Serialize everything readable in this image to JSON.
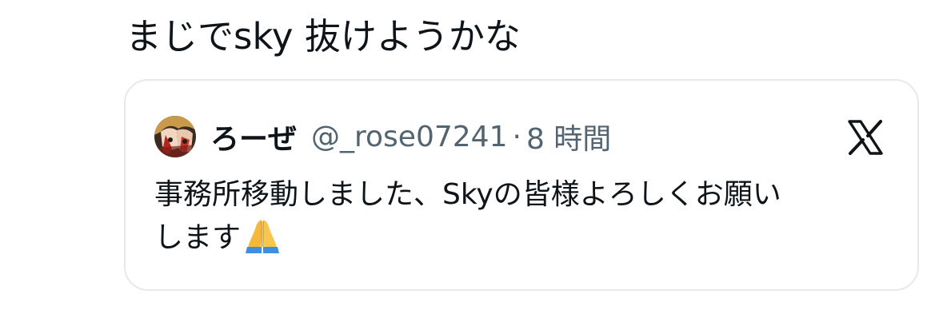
{
  "post": {
    "text": "まじでsky 抜けようかな"
  },
  "quote": {
    "author": {
      "display_name": "ろーぜ",
      "handle": "@_rose07241",
      "separator": "·",
      "timestamp": "8 時間"
    },
    "text_line1": "事務所移動しました、Skyの皆様よろしくお願い",
    "text_line2": "します",
    "emoji": "folded-hands",
    "brand_icon": "x-logo-icon"
  },
  "colors": {
    "text_primary": "#0f1419",
    "text_secondary": "#536471",
    "border": "#e6e9ec",
    "emoji_skin": "#f5b93a"
  }
}
